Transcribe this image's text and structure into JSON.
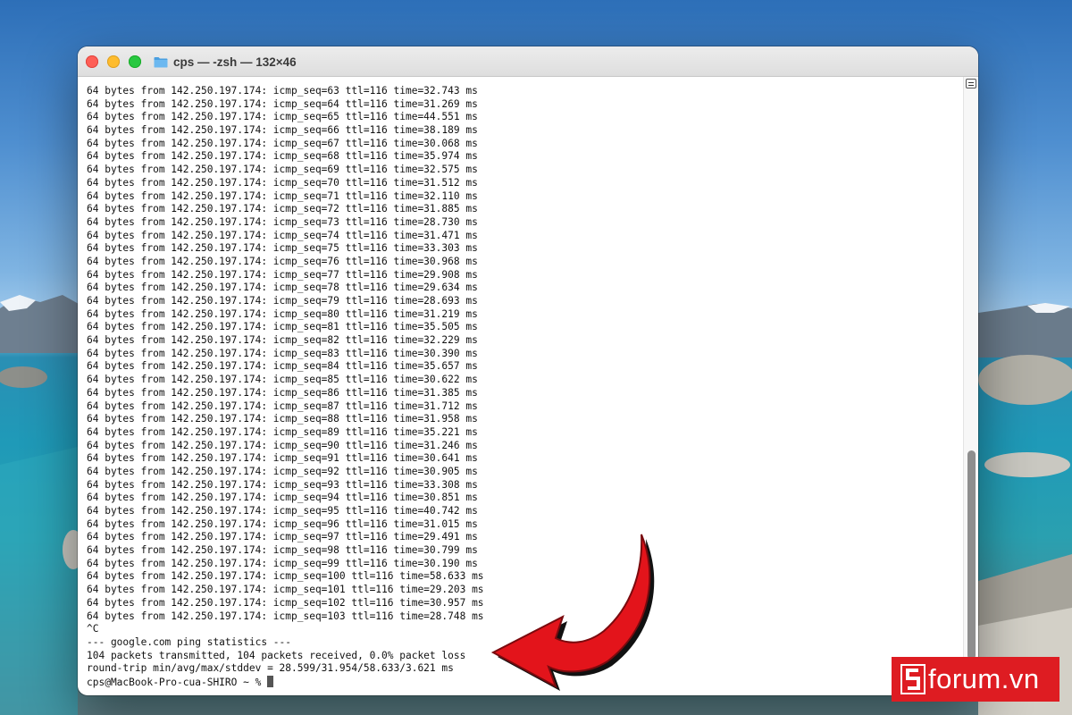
{
  "window": {
    "title": "cps — -zsh — 132×46"
  },
  "terminal": {
    "lines": [
      "64 bytes from 142.250.197.174: icmp_seq=63 ttl=116 time=32.743 ms",
      "64 bytes from 142.250.197.174: icmp_seq=64 ttl=116 time=31.269 ms",
      "64 bytes from 142.250.197.174: icmp_seq=65 ttl=116 time=44.551 ms",
      "64 bytes from 142.250.197.174: icmp_seq=66 ttl=116 time=38.189 ms",
      "64 bytes from 142.250.197.174: icmp_seq=67 ttl=116 time=30.068 ms",
      "64 bytes from 142.250.197.174: icmp_seq=68 ttl=116 time=35.974 ms",
      "64 bytes from 142.250.197.174: icmp_seq=69 ttl=116 time=32.575 ms",
      "64 bytes from 142.250.197.174: icmp_seq=70 ttl=116 time=31.512 ms",
      "64 bytes from 142.250.197.174: icmp_seq=71 ttl=116 time=32.110 ms",
      "64 bytes from 142.250.197.174: icmp_seq=72 ttl=116 time=31.885 ms",
      "64 bytes from 142.250.197.174: icmp_seq=73 ttl=116 time=28.730 ms",
      "64 bytes from 142.250.197.174: icmp_seq=74 ttl=116 time=31.471 ms",
      "64 bytes from 142.250.197.174: icmp_seq=75 ttl=116 time=33.303 ms",
      "64 bytes from 142.250.197.174: icmp_seq=76 ttl=116 time=30.968 ms",
      "64 bytes from 142.250.197.174: icmp_seq=77 ttl=116 time=29.908 ms",
      "64 bytes from 142.250.197.174: icmp_seq=78 ttl=116 time=29.634 ms",
      "64 bytes from 142.250.197.174: icmp_seq=79 ttl=116 time=28.693 ms",
      "64 bytes from 142.250.197.174: icmp_seq=80 ttl=116 time=31.219 ms",
      "64 bytes from 142.250.197.174: icmp_seq=81 ttl=116 time=35.505 ms",
      "64 bytes from 142.250.197.174: icmp_seq=82 ttl=116 time=32.229 ms",
      "64 bytes from 142.250.197.174: icmp_seq=83 ttl=116 time=30.390 ms",
      "64 bytes from 142.250.197.174: icmp_seq=84 ttl=116 time=35.657 ms",
      "64 bytes from 142.250.197.174: icmp_seq=85 ttl=116 time=30.622 ms",
      "64 bytes from 142.250.197.174: icmp_seq=86 ttl=116 time=31.385 ms",
      "64 bytes from 142.250.197.174: icmp_seq=87 ttl=116 time=31.712 ms",
      "64 bytes from 142.250.197.174: icmp_seq=88 ttl=116 time=31.958 ms",
      "64 bytes from 142.250.197.174: icmp_seq=89 ttl=116 time=35.221 ms",
      "64 bytes from 142.250.197.174: icmp_seq=90 ttl=116 time=31.246 ms",
      "64 bytes from 142.250.197.174: icmp_seq=91 ttl=116 time=30.641 ms",
      "64 bytes from 142.250.197.174: icmp_seq=92 ttl=116 time=30.905 ms",
      "64 bytes from 142.250.197.174: icmp_seq=93 ttl=116 time=33.308 ms",
      "64 bytes from 142.250.197.174: icmp_seq=94 ttl=116 time=30.851 ms",
      "64 bytes from 142.250.197.174: icmp_seq=95 ttl=116 time=40.742 ms",
      "64 bytes from 142.250.197.174: icmp_seq=96 ttl=116 time=31.015 ms",
      "64 bytes from 142.250.197.174: icmp_seq=97 ttl=116 time=29.491 ms",
      "64 bytes from 142.250.197.174: icmp_seq=98 ttl=116 time=30.799 ms",
      "64 bytes from 142.250.197.174: icmp_seq=99 ttl=116 time=30.190 ms",
      "64 bytes from 142.250.197.174: icmp_seq=100 ttl=116 time=58.633 ms",
      "64 bytes from 142.250.197.174: icmp_seq=101 ttl=116 time=29.203 ms",
      "64 bytes from 142.250.197.174: icmp_seq=102 ttl=116 time=30.957 ms",
      "64 bytes from 142.250.197.174: icmp_seq=103 ttl=116 time=28.748 ms",
      "^C",
      "--- google.com ping statistics ---",
      "104 packets transmitted, 104 packets received, 0.0% packet loss",
      "round-trip min/avg/max/stddev = 28.599/31.954/58.633/3.621 ms"
    ],
    "prompt": "cps@MacBook-Pro-cua-SHIRO ~ % "
  },
  "watermark": {
    "text": "forum.vn"
  },
  "colors": {
    "close": "#fe5f57",
    "minimize": "#febc2e",
    "maximize": "#28c840",
    "arrow": "#e3141b",
    "badge": "#de1c22"
  },
  "icons": [
    "folder-icon",
    "terminal-menu-icon",
    "arrow-annotation",
    "sforum-logo"
  ]
}
